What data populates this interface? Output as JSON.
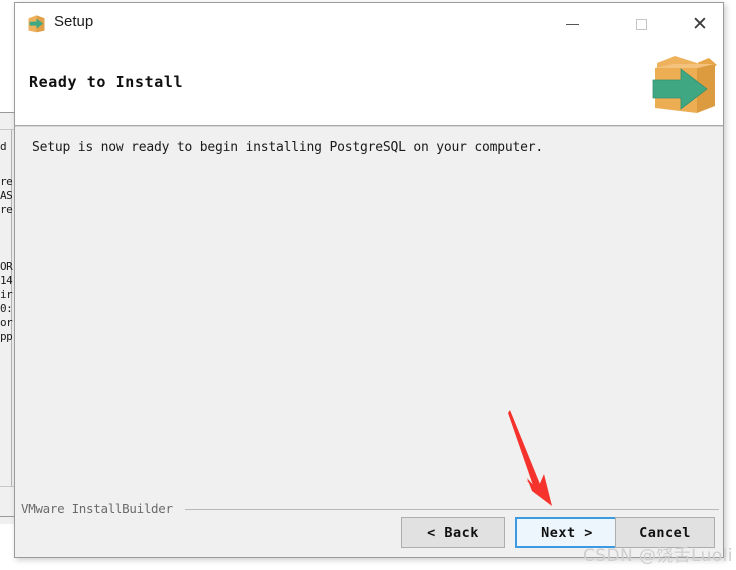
{
  "window": {
    "title": "Setup",
    "icon": "setup-box-arrow-icon",
    "controls": {
      "minimize": "minimize-icon",
      "maximize": "maximize-icon",
      "close": "close-icon"
    }
  },
  "header": {
    "title": "Ready to Install",
    "icon": "open-box-green-arrow-icon"
  },
  "body": {
    "message": "Setup is now ready to begin installing PostgreSQL on your computer."
  },
  "footer": {
    "brand": "VMware InstallBuilder",
    "buttons": {
      "back": "< Back",
      "next": "Next >",
      "cancel": "Cancel"
    }
  },
  "background_window": {
    "fragments": [
      "d",
      "re",
      "AS",
      "re",
      "OR",
      "14",
      "ir",
      "0:",
      "or",
      "pp"
    ]
  },
  "annotation": {
    "arrow": "red-pointer-arrow",
    "arrow_color": "#f6322c"
  },
  "watermark": {
    "text": "CSDN @饶舌Luoli",
    "color": "#cfcfcf"
  },
  "colors": {
    "dialog_bg": "#f0f0f0",
    "titlebar_bg": "#ffffff",
    "accent_blue": "#3d9ae0",
    "next_fill": "#eef6fd",
    "box_orange": "#eeb15c",
    "arrow_green": "#3fa883"
  }
}
